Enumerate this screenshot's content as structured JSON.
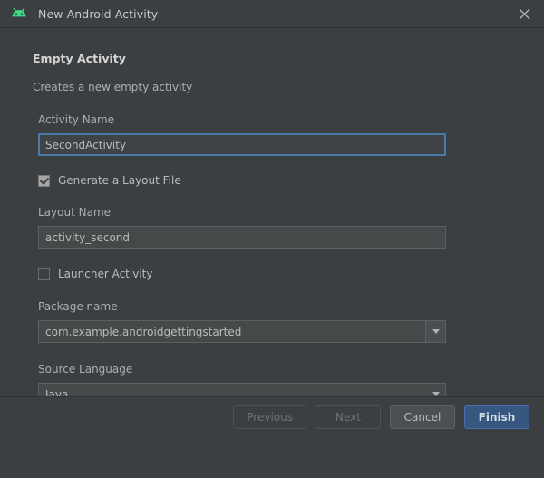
{
  "window": {
    "title": "New Android Activity",
    "app_icon": "android-robot-icon",
    "close_icon": "close-icon",
    "accent_color": "#365880",
    "focus_border_color": "#4a7ba8",
    "background_color": "#3c3f41",
    "android_green": "#3ddc84"
  },
  "template": {
    "heading": "Empty Activity",
    "description": "Creates a new empty activity"
  },
  "fields": {
    "activity_name": {
      "label": "Activity Name",
      "value": "SecondActivity",
      "placeholder": "",
      "focused": true
    },
    "generate_layout": {
      "label": "Generate a Layout File",
      "checked": true
    },
    "layout_name": {
      "label": "Layout Name",
      "value": "activity_second",
      "placeholder": "",
      "focused": false
    },
    "launcher_activity": {
      "label": "Launcher Activity",
      "checked": false
    },
    "package_name": {
      "label": "Package name",
      "value": "com.example.androidgettingstarted",
      "arrow_icon": "chevron-down-icon"
    },
    "source_language": {
      "label": "Source Language",
      "value": "Java",
      "arrow_icon": "chevron-down-icon"
    }
  },
  "footer": {
    "previous_label": "Previous",
    "next_label": "Next",
    "cancel_label": "Cancel",
    "finish_label": "Finish"
  }
}
